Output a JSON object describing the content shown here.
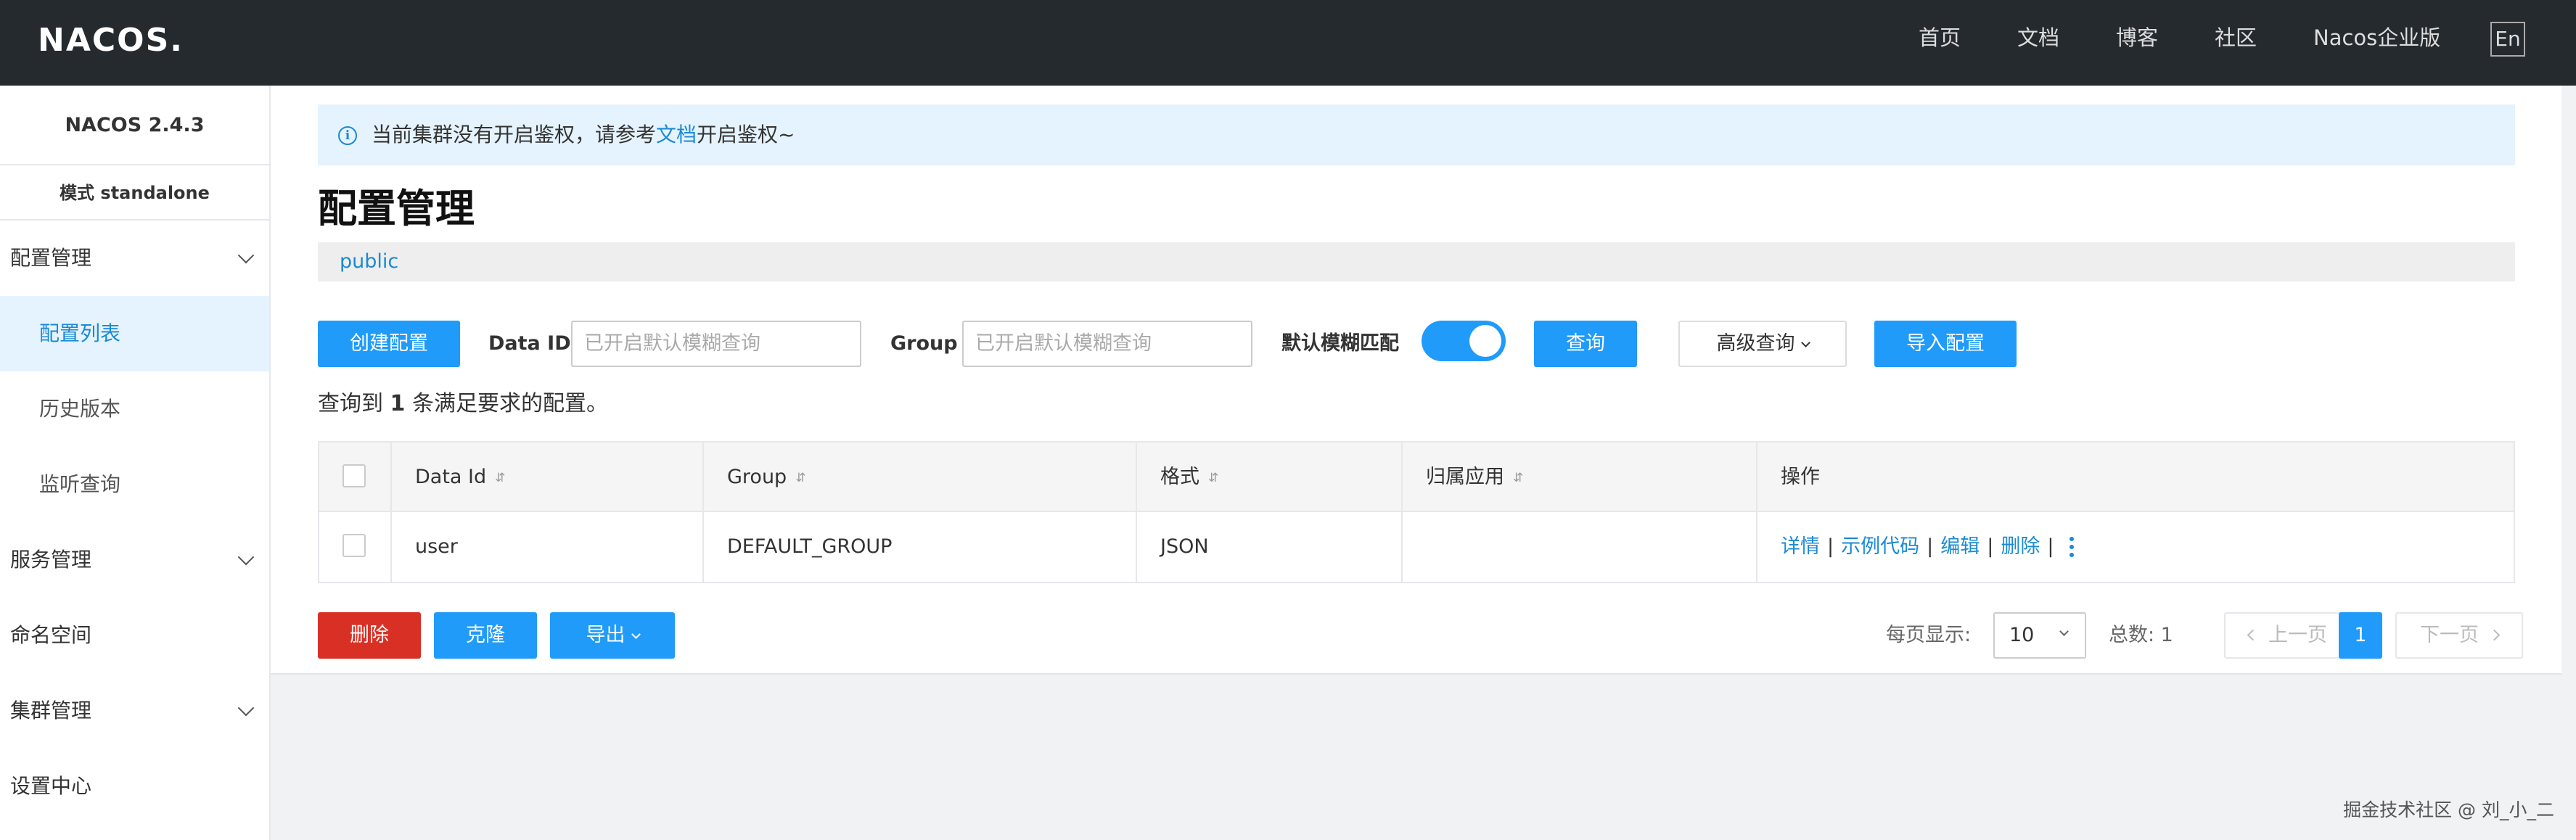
{
  "header": {
    "logo_text": "NACOS.",
    "nav": [
      "首页",
      "文档",
      "博客",
      "社区",
      "Nacos企业版"
    ],
    "lang_button": "En"
  },
  "sidebar": {
    "version": "NACOS 2.4.3",
    "mode": "模式  standalone",
    "items": [
      {
        "label": "配置管理"
      },
      {
        "label": "配置列表"
      },
      {
        "label": "历史版本"
      },
      {
        "label": "监听查询"
      },
      {
        "label": "服务管理"
      },
      {
        "label": "命名空间"
      },
      {
        "label": "集群管理"
      },
      {
        "label": "设置中心"
      }
    ]
  },
  "alert": {
    "text_before": "当前集群没有开启鉴权，请参考",
    "link": "文档",
    "text_after": "开启鉴权~"
  },
  "page_title": "配置管理",
  "namespace_tab": "public",
  "toolbar": {
    "create_button": "创建配置",
    "data_id_label": "Data ID",
    "data_id_placeholder": "已开启默认模糊查询",
    "group_label": "Group",
    "group_placeholder": "已开启默认模糊查询",
    "fuzzy_label": "默认模糊匹配",
    "fuzzy_enabled": true,
    "query_button": "查询",
    "advanced_query_button": "高级查询",
    "import_button": "导入配置"
  },
  "result": {
    "prefix": "查询到 ",
    "count": "1",
    "suffix": " 条满足要求的配置。"
  },
  "table": {
    "headers": [
      "Data Id",
      "Group",
      "格式",
      "归属应用",
      "操作"
    ],
    "rows": [
      {
        "data_id": "user",
        "group": "DEFAULT_GROUP",
        "format": "JSON",
        "app": ""
      }
    ],
    "ops": [
      "详情",
      "示例代码",
      "编辑",
      "删除"
    ]
  },
  "footer_actions": {
    "delete_button": "删除",
    "clone_button": "克隆",
    "export_button": "导出"
  },
  "pagination": {
    "per_page_label": "每页显示:",
    "per_page_value": "10",
    "total_label": "总数: 1",
    "prev": "上一页",
    "current_page": "1",
    "next": "下一页"
  },
  "watermark": "掘金技术社区 @ 刘_小_二",
  "colors": {
    "header_bg": "#252a2f",
    "primary": "#209bfa",
    "link": "#1a8ad5",
    "danger": "#d93026",
    "alert_bg": "#e5f3fe"
  }
}
